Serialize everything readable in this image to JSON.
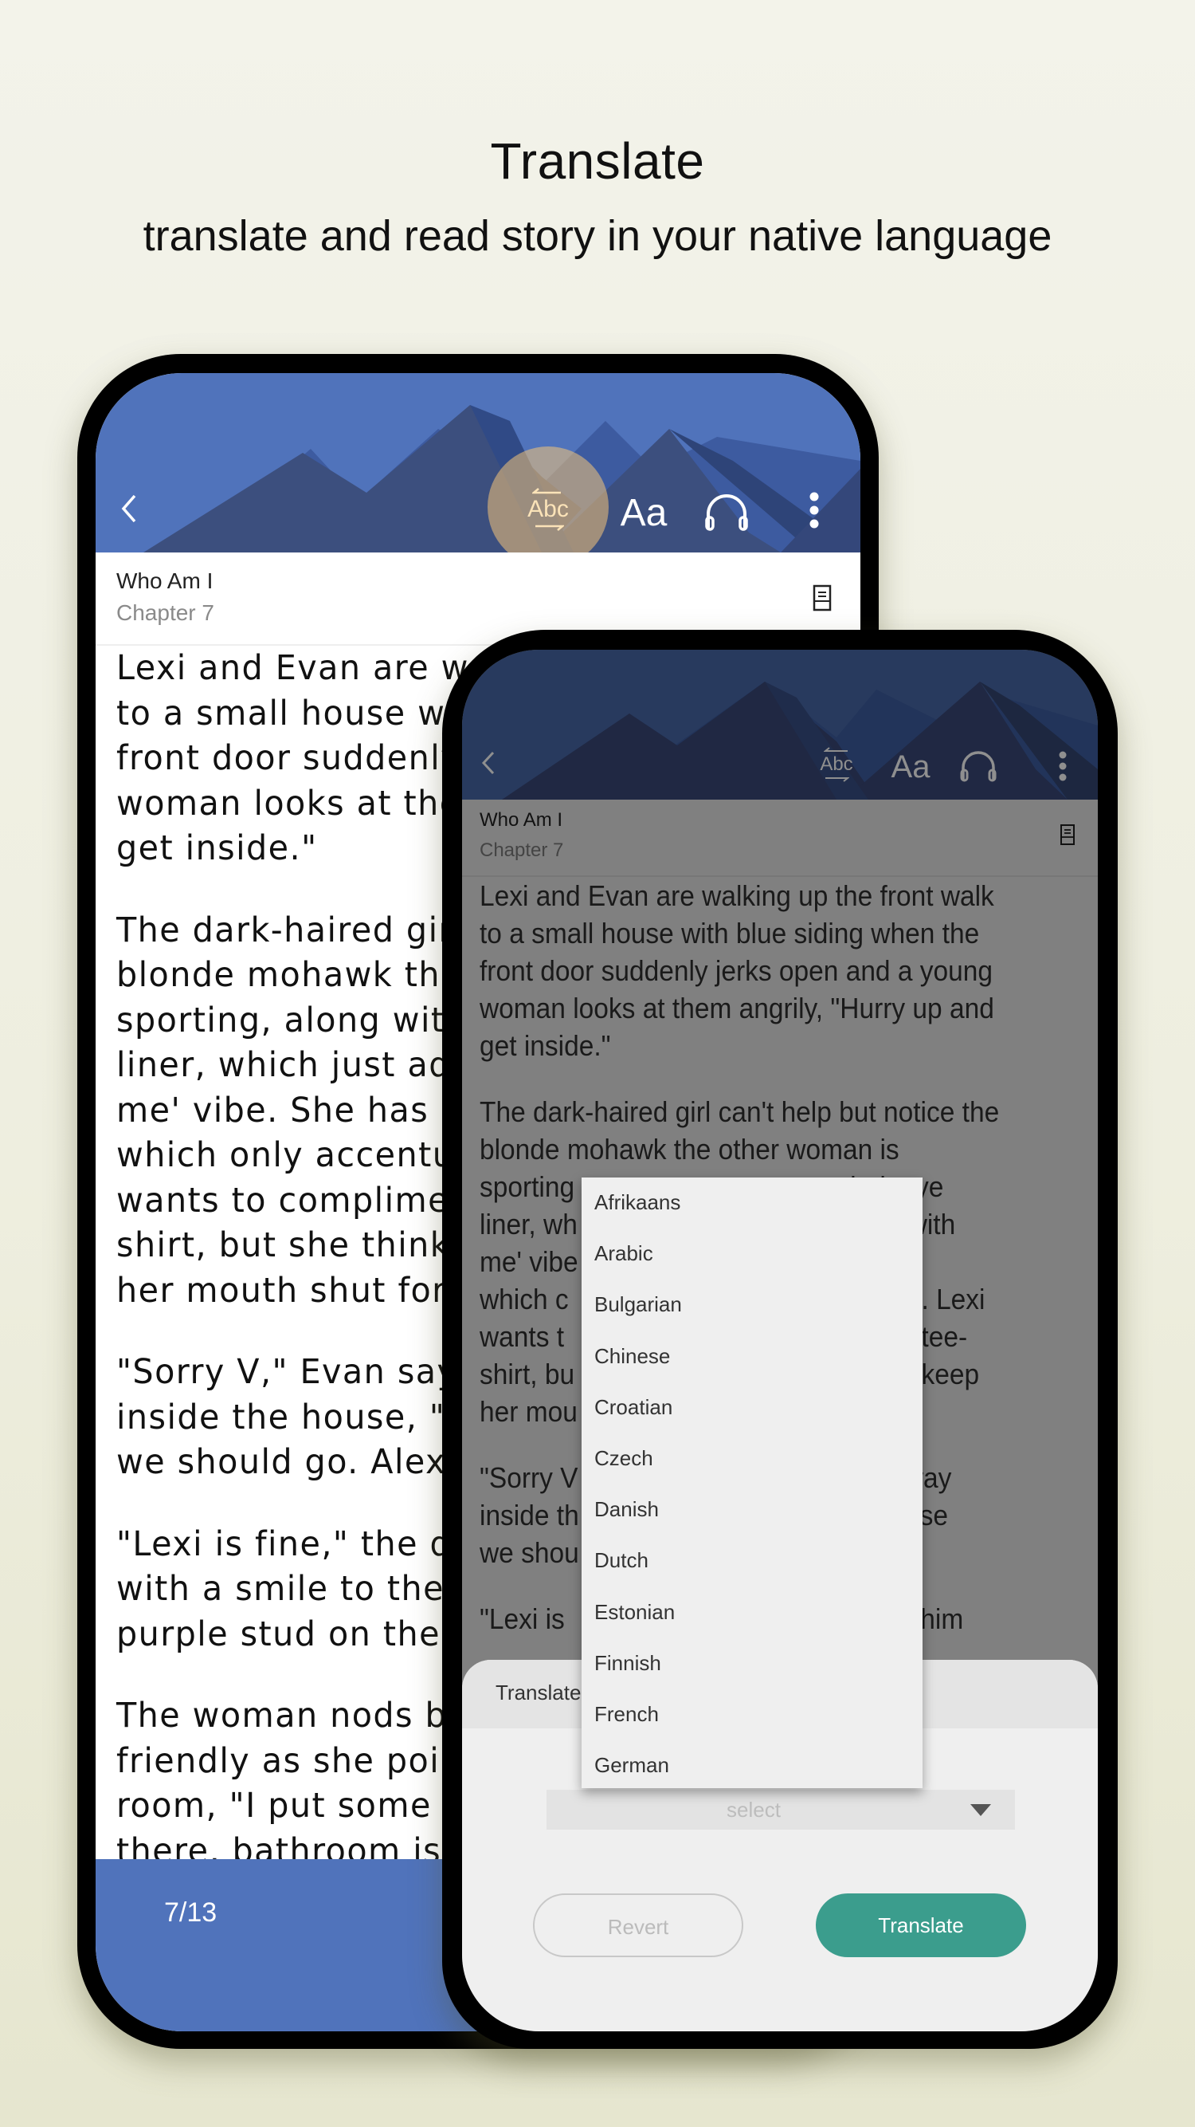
{
  "hero": {
    "title": "Translate",
    "subtitle": "translate and read story in your native language"
  },
  "colors": {
    "header_blue": "#5073bb",
    "header_blue_dimmed": "#283a5e",
    "highlight": "#f4c478",
    "translate_button": "#3b9d8d"
  },
  "reader": {
    "book_title": "Who Am I",
    "chapter": "Chapter 7",
    "toolbar_icons": [
      "back-icon",
      "translate-icon",
      "font-size-icon",
      "headphones-icon",
      "more-icon",
      "toc-icon"
    ],
    "translate_icon_label": "Abc",
    "font_size_icon_label": "Aa",
    "page_indicator": "7/13"
  },
  "left_story_lines": [
    [
      "Lexi and Evan are wa",
      "to a small house wit",
      "front door suddenly j",
      "woman looks at ther",
      "get inside.\""
    ],
    [
      "The dark-haired girl c",
      "blonde mohawk the",
      "sporting, along with",
      "liner, which just adds",
      "me' vibe. She has on",
      "which only accentua",
      "wants to complimen",
      "shirt, but she thinks i",
      "her mouth shut for n"
    ],
    [
      "\"Sorry V,\" Evan says a",
      "inside the house, \"I w",
      "we should go. Alexar"
    ],
    [
      "\"Lexi is fine,\" the dark",
      "with a smile to the w",
      "purple stud on the si"
    ],
    [
      "The woman nods bu",
      "friendly as she points",
      "room, \"I put some pil",
      "there, bathroom is d"
    ]
  ],
  "right_story_lines": [
    [
      "Lexi and Evan are walking up the front walk",
      "to a small house with blue siding when the",
      "front door suddenly jerks open and a young",
      "woman looks at them angrily, \"Hurry up and",
      "get inside.\""
    ],
    [
      "The dark-haired girl can't help but notice the",
      "blonde mohawk the other woman is",
      "sporting                                    dark eye",
      "liner, wh                                   mess with",
      "me' vibe                                    shorts,",
      "which c                                    an legs. Lexi",
      "wants t                                     Roses tee-",
      "shirt, bu                                   best to keep",
      "her mou"
    ],
    [
      "\"Sorry V                                    their way",
      "inside th                                   here else",
      "we shou                                       .\""
    ],
    [
      "\"Lexi is                                    orrects him"
    ]
  ],
  "translate_sheet": {
    "title": "Translate",
    "select_placeholder": "select",
    "revert_label": "Revert",
    "translate_label": "Translate"
  },
  "language_dropdown": {
    "options": [
      "Afrikaans",
      "Arabic",
      "Bulgarian",
      "Chinese",
      "Croatian",
      "Czech",
      "Danish",
      "Dutch",
      "Estonian",
      "Finnish",
      "French",
      "German"
    ]
  }
}
